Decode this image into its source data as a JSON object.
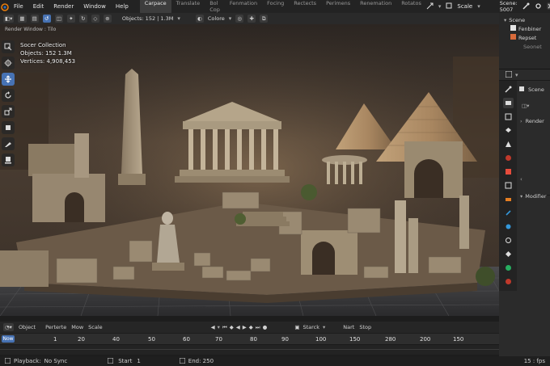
{
  "menubar": {
    "items": [
      "File",
      "Edit",
      "Render",
      "Window",
      "Help"
    ],
    "workspaces": [
      "Carpace",
      "Translate",
      "Bol Cop",
      "Fenmation",
      "Focing",
      "Rectects",
      "Perimens",
      "Renemation",
      "Rotatos"
    ],
    "active_workspace_index": 0,
    "scale_label": "Scale",
    "scene_label": "Scene: 5007"
  },
  "header": {
    "objects_label": "Objects: 152 | 1.3M",
    "colors_label": "Colore"
  },
  "viewport": {
    "title": "Render Window : Tilo",
    "stats": {
      "collection": "Socer Collection",
      "objects": "Objects: 152  1.3M",
      "vertices": "Vertices: 4,908,453"
    }
  },
  "outliner": {
    "rows": [
      "Scene",
      "Fenbiner",
      "Repset",
      "Seonet"
    ]
  },
  "properties": {
    "scene_label": "Scene",
    "render_label": "Render",
    "modifier_label": "Modifier"
  },
  "timeline": {
    "object_label": "Object",
    "perterte_label": "Perterte",
    "mow_label": "Mow",
    "scale_label": "Scale",
    "starck_label": "Starck",
    "nart_label": "Nart",
    "stop_label": "Stop",
    "current_frame": "Now",
    "ruler_numbers": [
      "1",
      "20",
      "40",
      "50",
      "60",
      "70",
      "80",
      "90",
      "100",
      "150",
      "280",
      "200",
      "150"
    ]
  },
  "status": {
    "playback": "Playback:",
    "sync": "No Sync",
    "start": "Start",
    "start_value": "1",
    "end": "End: 250",
    "fps": "15 : fps"
  },
  "colors": {
    "accent": "#4772b3",
    "stone": "#a89880",
    "sky": "#3a3129"
  }
}
